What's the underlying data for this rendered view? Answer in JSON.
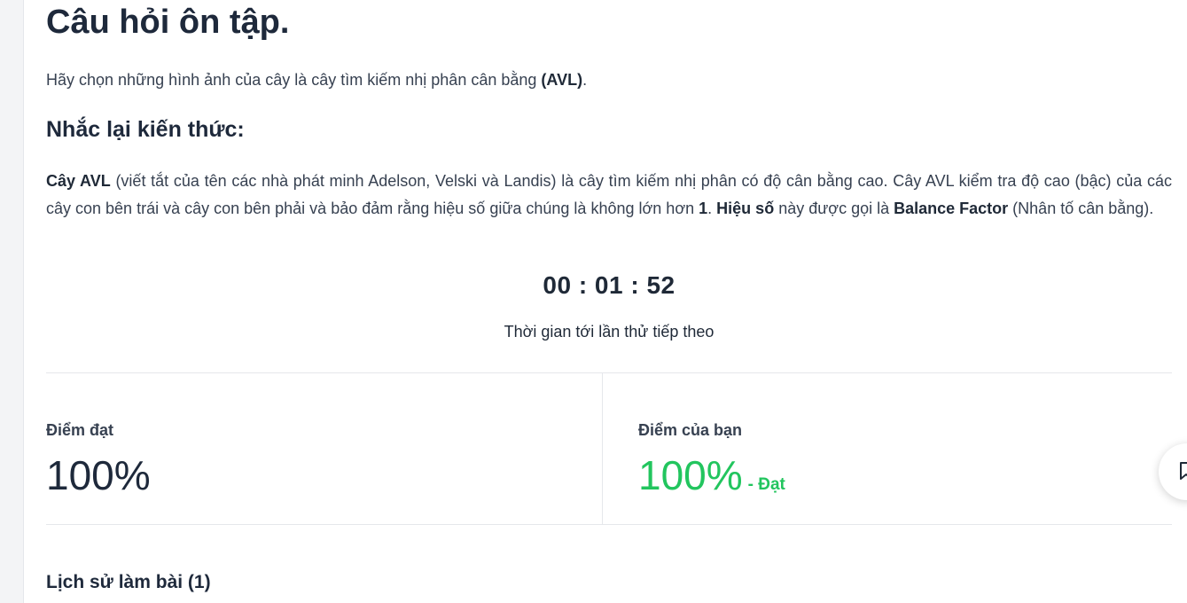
{
  "page": {
    "title": "Câu hỏi ôn tập.",
    "prompt_text": "Hãy chọn những hình ảnh của cây là cây tìm kiếm nhị phân cân bằng ",
    "prompt_bold": "(AVL)",
    "prompt_end": "."
  },
  "knowledge": {
    "heading": "Nhắc lại kiến thức:",
    "part1_bold": "Cây AVL",
    "part2": " (viết tắt của tên các nhà phát minh Adelson, Velski và Landis) là cây tìm kiếm nhị phân có độ cân bằng cao. Cây AVL kiểm tra độ cao (bậc) của các cây con bên trái và cây con bên phải và bảo đảm rằng hiệu số giữa chúng là không lớn hơn ",
    "part3_bold": "1",
    "part4": ". ",
    "part5_bold": "Hiệu số",
    "part6": " này được gọi là ",
    "part7_bold": "Balance Factor",
    "part8": " (Nhân tố cân bằng)."
  },
  "timer": {
    "value": "00 : 01 : 52",
    "caption": "Thời gian tới lần thử tiếp theo"
  },
  "scores": {
    "pass_label": "Điểm đạt",
    "pass_value": "100%",
    "your_label": "Điểm của bạn",
    "your_value": "100%",
    "your_status": "- Đạt",
    "status_color": "#22c55e"
  },
  "history": {
    "heading": "Lịch sử làm bài (1)"
  },
  "float_button": {
    "icon": "bookmark-icon"
  }
}
